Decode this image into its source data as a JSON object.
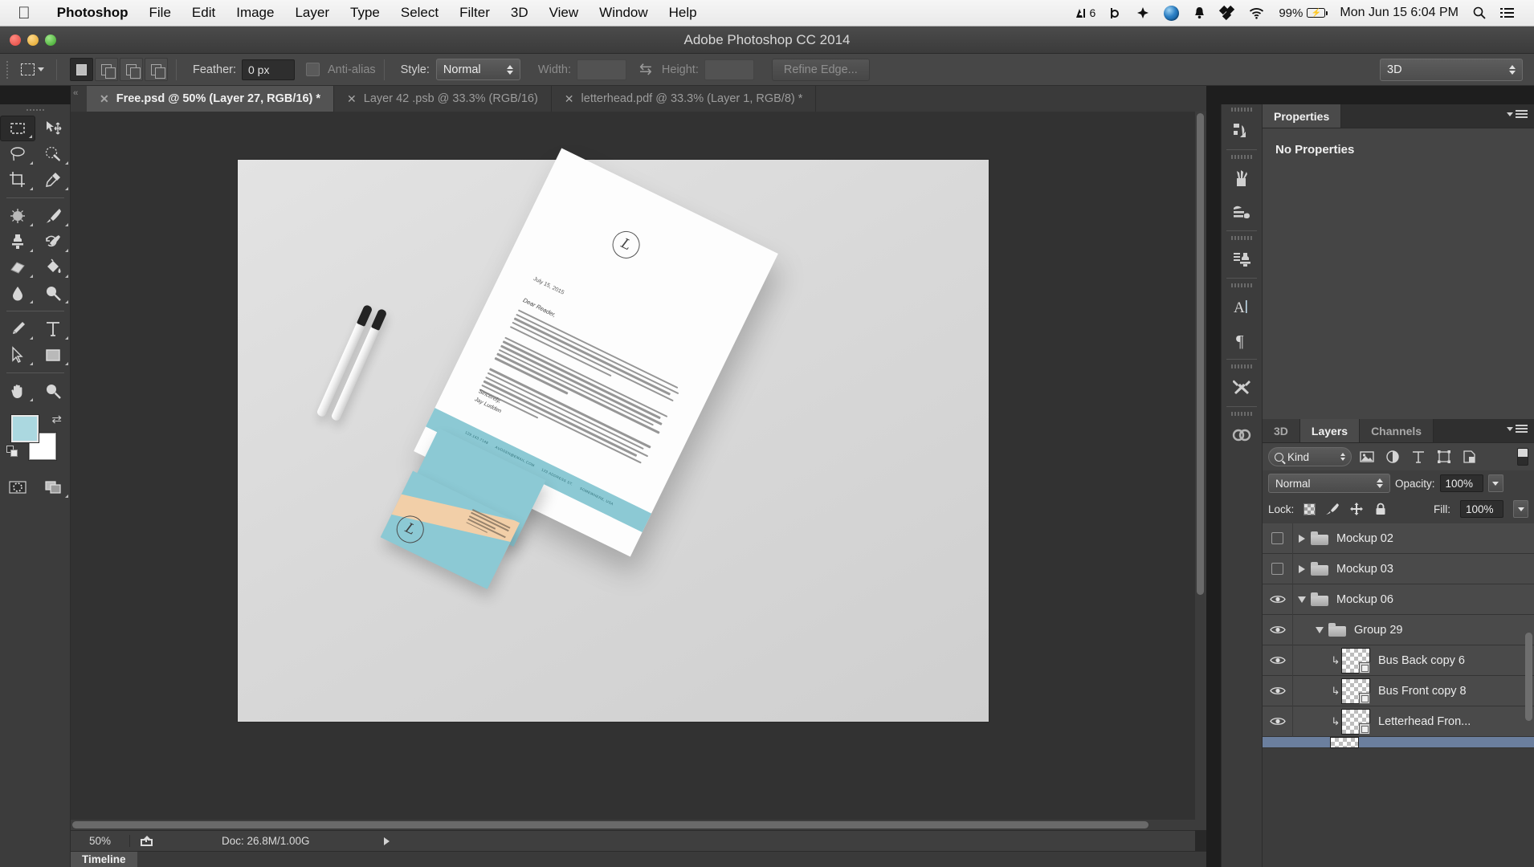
{
  "macbar": {
    "apple_icon": "apple-logo-icon",
    "menus": [
      {
        "label": "Photoshop",
        "bold": true
      },
      {
        "label": "File",
        "bold": false
      },
      {
        "label": "Edit",
        "bold": false
      },
      {
        "label": "Image",
        "bold": false
      },
      {
        "label": "Layer",
        "bold": false
      },
      {
        "label": "Type",
        "bold": false
      },
      {
        "label": "Select",
        "bold": false
      },
      {
        "label": "Filter",
        "bold": false
      },
      {
        "label": "3D",
        "bold": false
      },
      {
        "label": "View",
        "bold": false
      },
      {
        "label": "Window",
        "bold": false
      },
      {
        "label": "Help",
        "bold": false
      }
    ],
    "status": {
      "adobe_badge": "6",
      "battery_percent": "99%",
      "datetime": "Mon Jun 15  6:04 PM",
      "search_icon": "search-icon",
      "notifications_icon": "list-menu-icon"
    }
  },
  "window": {
    "title": "Adobe Photoshop CC 2014"
  },
  "options_bar": {
    "feather_label": "Feather:",
    "feather_value": "0 px",
    "antialias_label": "Anti-alias",
    "style_label": "Style:",
    "style_value": "Normal",
    "width_label": "Width:",
    "width_value": "",
    "height_label": "Height:",
    "height_value": "",
    "refine_edge_label": "Refine Edge...",
    "workspace_value": "3D"
  },
  "tabs": [
    {
      "label": "Free.psd @ 50% (Layer 27, RGB/16) *",
      "active": true
    },
    {
      "label": "Layer 42 .psb @ 33.3% (RGB/16)",
      "active": false
    },
    {
      "label": "letterhead.pdf @ 33.3% (Layer 1, RGB/8) *",
      "active": false
    }
  ],
  "toolbar": {
    "tools": [
      {
        "name": "rectangular-marquee-tool",
        "selected": true
      },
      {
        "name": "move-tool",
        "selected": false
      },
      {
        "name": "lasso-tool",
        "selected": false
      },
      {
        "name": "quick-selection-tool",
        "selected": false
      },
      {
        "name": "crop-tool",
        "selected": false
      },
      {
        "name": "eyedropper-tool",
        "selected": false
      },
      {
        "name": "spot-healing-brush-tool",
        "selected": false
      },
      {
        "name": "brush-tool",
        "selected": false
      },
      {
        "name": "clone-stamp-tool",
        "selected": false
      },
      {
        "name": "history-brush-tool",
        "selected": false
      },
      {
        "name": "eraser-tool",
        "selected": false
      },
      {
        "name": "paint-bucket-tool",
        "selected": false
      },
      {
        "name": "blur-tool",
        "selected": false
      },
      {
        "name": "dodge-tool",
        "selected": false
      },
      {
        "name": "pen-tool",
        "selected": false
      },
      {
        "name": "type-tool",
        "selected": false
      },
      {
        "name": "path-selection-tool",
        "selected": false
      },
      {
        "name": "rectangle-shape-tool",
        "selected": false
      },
      {
        "name": "hand-tool",
        "selected": false
      },
      {
        "name": "zoom-tool",
        "selected": false
      }
    ],
    "foreground_color": "#abd8e0",
    "background_color": "#ffffff"
  },
  "icon_dock": [
    {
      "name": "history-icon"
    },
    {
      "name": "brush-presets-icon"
    },
    {
      "name": "brush-settings-icon"
    },
    {
      "name": "clone-source-icon"
    },
    {
      "name": "character-icon"
    },
    {
      "name": "paragraph-icon"
    },
    {
      "name": "tool-presets-icon"
    },
    {
      "name": "creative-cloud-icon"
    }
  ],
  "properties_panel": {
    "tab_label": "Properties",
    "empty_message": "No Properties"
  },
  "layers_panel": {
    "tabs": [
      {
        "label": "3D",
        "active": false
      },
      {
        "label": "Layers",
        "active": true
      },
      {
        "label": "Channels",
        "active": false
      }
    ],
    "filter_kind": "Kind",
    "filter_icons": [
      "image-filter-icon",
      "adjustment-filter-icon",
      "type-filter-icon",
      "shape-filter-icon",
      "smart-object-filter-icon"
    ],
    "blend_mode": "Normal",
    "opacity_label": "Opacity:",
    "opacity_value": "100%",
    "lock_label": "Lock:",
    "fill_label": "Fill:",
    "fill_value": "100%",
    "lock_icons": [
      "lock-transparent-pixels-icon",
      "lock-image-pixels-icon",
      "lock-position-icon",
      "lock-all-icon"
    ],
    "layers": [
      {
        "name": "Mockup 02",
        "type": "group",
        "visible": false,
        "expanded": false,
        "indent": 0,
        "selected": false
      },
      {
        "name": "Mockup 03",
        "type": "group",
        "visible": false,
        "expanded": false,
        "indent": 0,
        "selected": false
      },
      {
        "name": "Mockup 06",
        "type": "group",
        "visible": true,
        "expanded": true,
        "indent": 0,
        "selected": false
      },
      {
        "name": "Group 29",
        "type": "group",
        "visible": true,
        "expanded": true,
        "indent": 1,
        "selected": false
      },
      {
        "name": "Bus Back copy 6",
        "type": "layer",
        "visible": true,
        "clipped": true,
        "indent": 2,
        "selected": false
      },
      {
        "name": "Bus Front copy 8",
        "type": "layer",
        "visible": true,
        "clipped": true,
        "indent": 2,
        "selected": false
      },
      {
        "name": "Letterhead Fron...",
        "type": "layer",
        "visible": true,
        "clipped": true,
        "indent": 2,
        "selected": false
      },
      {
        "name": "",
        "type": "layer",
        "visible": true,
        "clipped": true,
        "indent": 2,
        "selected": true
      }
    ],
    "footer_icons": [
      "link-layers-icon",
      "layer-style-icon",
      "layer-mask-icon",
      "adjustment-layer-icon",
      "new-group-icon",
      "new-layer-icon",
      "delete-layer-icon"
    ]
  },
  "status_bar": {
    "zoom": "50%",
    "share_icon": "share-icon",
    "doc_info": "Doc: 26.8M/1.00G"
  },
  "timeline": {
    "label": "Timeline"
  },
  "canvas": {
    "letterhead": {
      "date": "July 15, 2015",
      "salutation": "Dear Reader,",
      "signoff_line1": "Sincerely,",
      "signoff_line2": "Jay Ludden",
      "contact": [
        "129.163.7148",
        "AUDDEN@EMAIL.COM",
        "123 ADDRESS ST.",
        "SOMEWHERE, USA"
      ],
      "accent_color": "#8cc9d4",
      "logo_glyph": "L"
    },
    "business_cards": {
      "front_color": "#8cc9d4",
      "back_color": "#f2cfa8",
      "logo_glyph": "L"
    }
  }
}
